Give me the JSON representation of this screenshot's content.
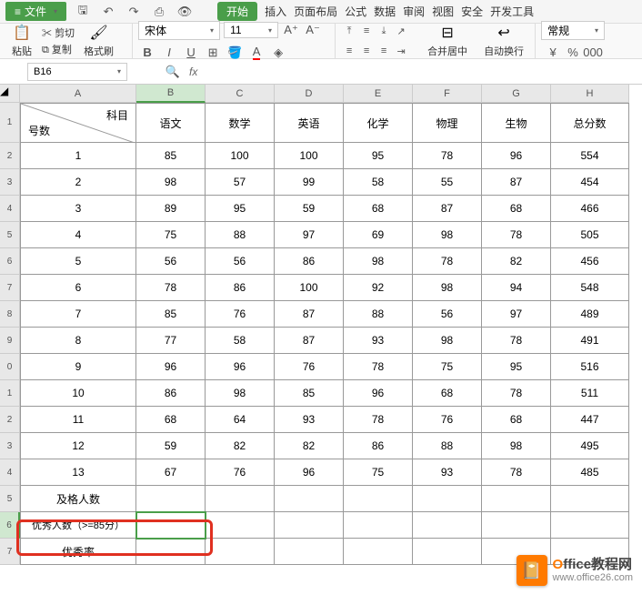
{
  "menu": {
    "file": "文件",
    "tabs": [
      "开始",
      "插入",
      "页面布局",
      "公式",
      "数据",
      "审阅",
      "视图",
      "安全",
      "开发工具"
    ]
  },
  "ribbon": {
    "cut": "剪切",
    "copy": "复制",
    "format_painter": "格式刷",
    "paste": "粘贴",
    "font_name": "宋体",
    "font_size": "11",
    "merge": "合并居中",
    "wrap": "自动换行",
    "number_format": "常规"
  },
  "namebox": "B16",
  "fx": "fx",
  "columns": [
    "A",
    "B",
    "C",
    "D",
    "E",
    "F",
    "G",
    "H"
  ],
  "row_labels": [
    "1",
    "2",
    "3",
    "4",
    "5",
    "6",
    "7",
    "8",
    "9",
    "0",
    "1",
    "2",
    "3",
    "4",
    "5",
    "6",
    "7"
  ],
  "header": {
    "diag_top": "科目",
    "diag_bottom": "号数",
    "subjects": [
      "语文",
      "数学",
      "英语",
      "化学",
      "物理",
      "生物",
      "总分数"
    ]
  },
  "rows": [
    {
      "id": "1",
      "v": [
        "85",
        "100",
        "100",
        "95",
        "78",
        "96",
        "554"
      ]
    },
    {
      "id": "2",
      "v": [
        "98",
        "57",
        "99",
        "58",
        "55",
        "87",
        "454"
      ]
    },
    {
      "id": "3",
      "v": [
        "89",
        "95",
        "59",
        "68",
        "87",
        "68",
        "466"
      ]
    },
    {
      "id": "4",
      "v": [
        "75",
        "88",
        "97",
        "69",
        "98",
        "78",
        "505"
      ]
    },
    {
      "id": "5",
      "v": [
        "56",
        "56",
        "86",
        "98",
        "78",
        "82",
        "456"
      ]
    },
    {
      "id": "6",
      "v": [
        "78",
        "86",
        "100",
        "92",
        "98",
        "94",
        "548"
      ]
    },
    {
      "id": "7",
      "v": [
        "85",
        "76",
        "87",
        "88",
        "56",
        "97",
        "489"
      ]
    },
    {
      "id": "8",
      "v": [
        "77",
        "58",
        "87",
        "93",
        "98",
        "78",
        "491"
      ]
    },
    {
      "id": "9",
      "v": [
        "96",
        "96",
        "76",
        "78",
        "75",
        "95",
        "516"
      ]
    },
    {
      "id": "10",
      "v": [
        "86",
        "98",
        "85",
        "96",
        "68",
        "78",
        "511"
      ]
    },
    {
      "id": "11",
      "v": [
        "68",
        "64",
        "93",
        "78",
        "76",
        "68",
        "447"
      ]
    },
    {
      "id": "12",
      "v": [
        "59",
        "82",
        "82",
        "86",
        "88",
        "98",
        "495"
      ]
    },
    {
      "id": "13",
      "v": [
        "67",
        "76",
        "96",
        "75",
        "93",
        "78",
        "485"
      ]
    }
  ],
  "footer": {
    "pass": "及格人数",
    "excellent": "优秀人数（>=85分）",
    "rate": "优秀率"
  },
  "watermark": {
    "title_o": "O",
    "title_rest": "ffice教程网",
    "url": "www.office26.com",
    "icon": "📔"
  }
}
